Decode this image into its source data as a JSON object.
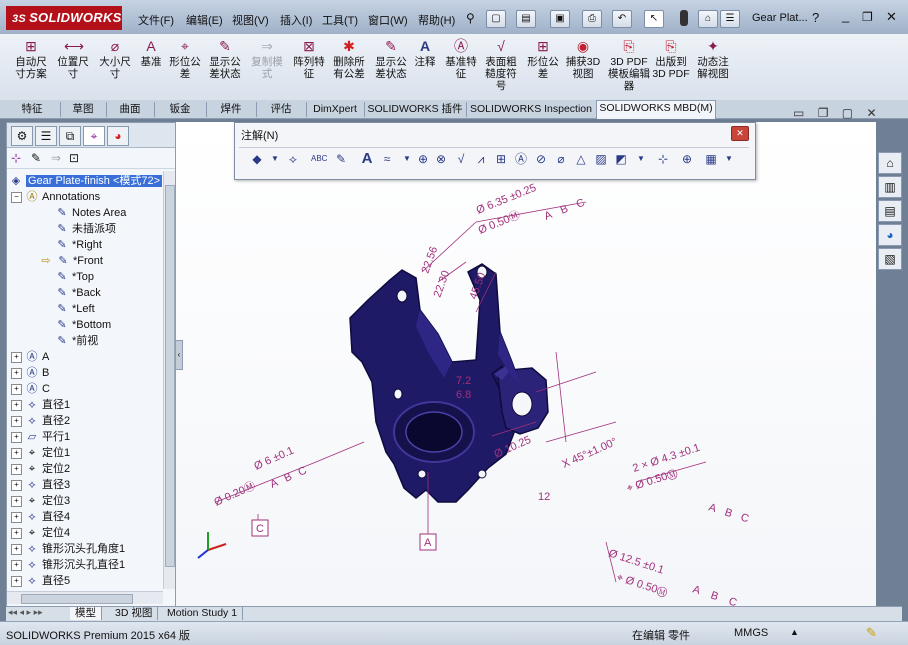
{
  "app": {
    "logo_text": "SOLIDWORKS",
    "logo_prefix": "3S",
    "document_title": "Gear Plat..."
  },
  "menu": [
    {
      "label": "文件(F)"
    },
    {
      "label": "编辑(E)"
    },
    {
      "label": "视图(V)"
    },
    {
      "label": "插入(I)"
    },
    {
      "label": "工具(T)"
    },
    {
      "label": "窗口(W)"
    },
    {
      "label": "帮助(H)"
    }
  ],
  "command_manager": [
    {
      "label": "自动尺寸方案",
      "icon": "auto-dimension-icon",
      "enabled": true
    },
    {
      "label": "位置尺寸",
      "icon": "location-dimension-icon",
      "enabled": true
    },
    {
      "label": "大小尺寸",
      "icon": "size-dimension-icon",
      "enabled": true
    },
    {
      "label": "基准",
      "icon": "datum-icon",
      "enabled": true
    },
    {
      "label": "形位公差",
      "icon": "geometric-tolerance-icon",
      "enabled": true
    },
    {
      "label": "显示公差状态",
      "icon": "tolerance-status-icon",
      "enabled": true
    },
    {
      "label": "复制模式",
      "icon": "copy-scheme-icon",
      "enabled": false
    },
    {
      "label": "阵列特征",
      "icon": "pattern-feature-icon",
      "enabled": true
    },
    {
      "label": "删除所有公差",
      "icon": "delete-tolerances-icon",
      "enabled": true
    },
    {
      "label": "显示公差状态",
      "icon": "show-tolerance-status-icon",
      "enabled": true
    },
    {
      "label": "注释",
      "icon": "note-icon",
      "enabled": true
    },
    {
      "label": "基准特征",
      "icon": "datum-feature-icon",
      "enabled": true
    },
    {
      "label": "表面粗糙度符号",
      "icon": "surface-finish-icon",
      "enabled": true
    },
    {
      "label": "形位公差",
      "icon": "gtol-icon",
      "enabled": true
    },
    {
      "label": "捕获3D视图",
      "icon": "capture-3d-view-icon",
      "enabled": true
    },
    {
      "label": "3D PDF模板编辑器",
      "icon": "pdf-template-icon",
      "enabled": true
    },
    {
      "label": "出版到3D PDF",
      "icon": "publish-pdf-icon",
      "enabled": true
    },
    {
      "label": "动态注解视图",
      "icon": "dynamic-annotation-icon",
      "enabled": true
    }
  ],
  "tabs": [
    {
      "label": "特征"
    },
    {
      "label": "草图"
    },
    {
      "label": "曲面"
    },
    {
      "label": "钣金"
    },
    {
      "label": "焊件"
    },
    {
      "label": "评估"
    },
    {
      "label": "DimXpert"
    },
    {
      "label": "SOLIDWORKS 插件"
    },
    {
      "label": "SOLIDWORKS Inspection"
    },
    {
      "label": "SOLIDWORKS MBD(M)"
    }
  ],
  "annotation_toolbar": {
    "title": "注解(N)"
  },
  "tree": {
    "root": "Gear Plate-finish  <模式72>",
    "annotations": "Annotations",
    "children": [
      {
        "label": "Notes Area"
      },
      {
        "label": "未插派项"
      },
      {
        "label": "*Right"
      },
      {
        "label": "*Front"
      },
      {
        "label": "*Top"
      },
      {
        "label": "*Back"
      },
      {
        "label": "*Left"
      },
      {
        "label": "*Bottom"
      },
      {
        "label": "*前视"
      }
    ],
    "items": [
      {
        "label": "A"
      },
      {
        "label": "B"
      },
      {
        "label": "C"
      },
      {
        "label": "直径1"
      },
      {
        "label": "直径2"
      },
      {
        "label": "平行1"
      },
      {
        "label": "定位1"
      },
      {
        "label": "定位2"
      },
      {
        "label": "直径3"
      },
      {
        "label": "定位3"
      },
      {
        "label": "直径4"
      },
      {
        "label": "定位4"
      },
      {
        "label": "锥形沉头孔角度1"
      },
      {
        "label": "锥形沉头孔直径1"
      },
      {
        "label": "直径5"
      }
    ]
  },
  "model_annotations": {
    "dims": [
      "Ø 6.35 ±0.25",
      "Ø 0.50Ⓜ",
      "A",
      "B",
      "C",
      "22.56",
      "22.30",
      "45.50",
      "7.2",
      "6.8",
      "Ø 6 ±0.1",
      "Ø 0.20Ⓜ",
      "A",
      "B",
      "C",
      "12",
      "Ø 10.25",
      "X 45°±1.00°",
      "2 × Ø 4.3 ±0.1",
      "⌖ Ø 0.50Ⓜ",
      "A",
      "B",
      "C",
      "Ø 12.5 ±0.1",
      "⌖ Ø 0.50Ⓜ",
      "A",
      "B",
      "C",
      "A",
      "C"
    ]
  },
  "bottom_tabs": [
    {
      "label": "模型"
    },
    {
      "label": "3D 视图"
    },
    {
      "label": "Motion Study 1"
    }
  ],
  "status": {
    "product": "SOLIDWORKS Premium 2015 x64 版",
    "mode": "在编辑 零件",
    "units": "MMGS"
  },
  "colors": {
    "model": "#1f1a66",
    "annotation": "#a0307c",
    "accent": "#3a6fd8",
    "logo_bg": "#b3101a"
  }
}
